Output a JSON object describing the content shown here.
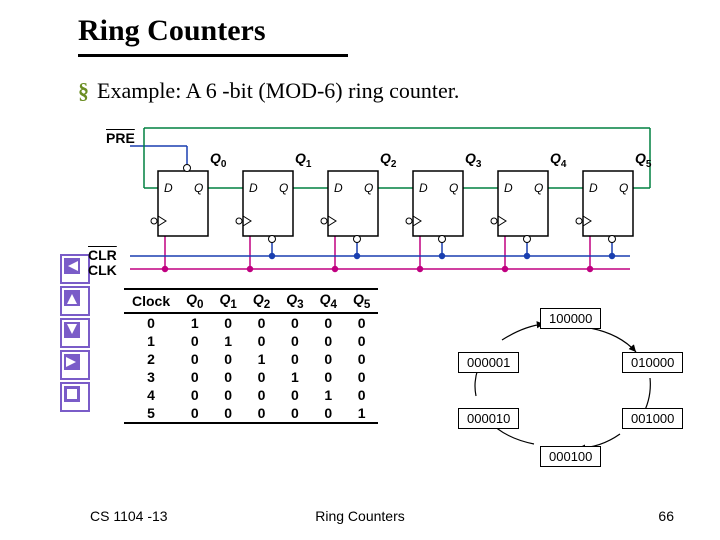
{
  "header": {
    "title": "Ring Counters"
  },
  "bullet": {
    "marker": "§",
    "text": "Example: A 6 -bit (MOD-6) ring counter."
  },
  "signals": {
    "pre": "PRE",
    "clr": "CLR",
    "clk": "CLK"
  },
  "flipflops": [
    {
      "q": "Q",
      "qsub": "0",
      "d": "D",
      "qpin": "Q"
    },
    {
      "q": "Q",
      "qsub": "1",
      "d": "D",
      "qpin": "Q"
    },
    {
      "q": "Q",
      "qsub": "2",
      "d": "D",
      "qpin": "Q"
    },
    {
      "q": "Q",
      "qsub": "3",
      "d": "D",
      "qpin": "Q"
    },
    {
      "q": "Q",
      "qsub": "4",
      "d": "D",
      "qpin": "Q"
    },
    {
      "q": "Q",
      "qsub": "5",
      "d": "D",
      "qpin": "Q"
    }
  ],
  "table": {
    "headers": [
      "Clock",
      "Q0",
      "Q1",
      "Q2",
      "Q3",
      "Q4",
      "Q5"
    ],
    "rows": [
      [
        "0",
        "1",
        "0",
        "0",
        "0",
        "0",
        "0"
      ],
      [
        "1",
        "0",
        "1",
        "0",
        "0",
        "0",
        "0"
      ],
      [
        "2",
        "0",
        "0",
        "1",
        "0",
        "0",
        "0"
      ],
      [
        "3",
        "0",
        "0",
        "0",
        "1",
        "0",
        "0"
      ],
      [
        "4",
        "0",
        "0",
        "0",
        "0",
        "1",
        "0"
      ],
      [
        "5",
        "0",
        "0",
        "0",
        "0",
        "0",
        "1"
      ]
    ]
  },
  "states": {
    "s100000": "100000",
    "s010000": "010000",
    "s001000": "001000",
    "s000100": "000100",
    "s000010": "000010",
    "s000001": "000001"
  },
  "footer": {
    "left": "CS 1104 -13",
    "center": "Ring Counters",
    "right": "66"
  }
}
